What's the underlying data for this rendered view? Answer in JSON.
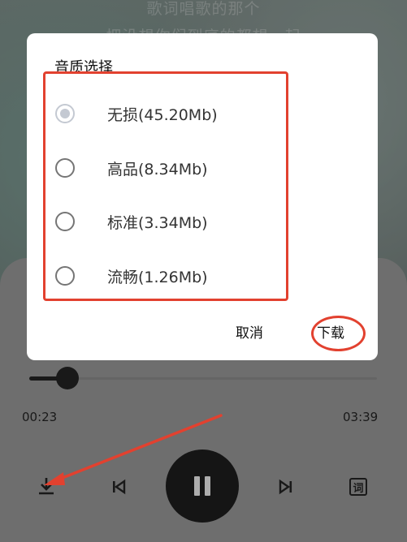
{
  "background": {
    "lyric_lines": [
      "歌词唱歌的那个",
      "把没想你们到底的都想一起"
    ]
  },
  "dialog": {
    "title": "音质选择",
    "options": [
      {
        "label": "无损(45.20Mb)",
        "selected": true
      },
      {
        "label": "高品(8.34Mb)",
        "selected": false
      },
      {
        "label": "标准(3.34Mb)",
        "selected": false
      },
      {
        "label": "流畅(1.26Mb)",
        "selected": false
      }
    ],
    "cancel_label": "取消",
    "download_label": "下载"
  },
  "player": {
    "current_time": "00:23",
    "total_time": "03:39",
    "progress_fraction": 0.11,
    "lyrics_icon_glyph": "词"
  },
  "annotation_color": "#e2412f"
}
